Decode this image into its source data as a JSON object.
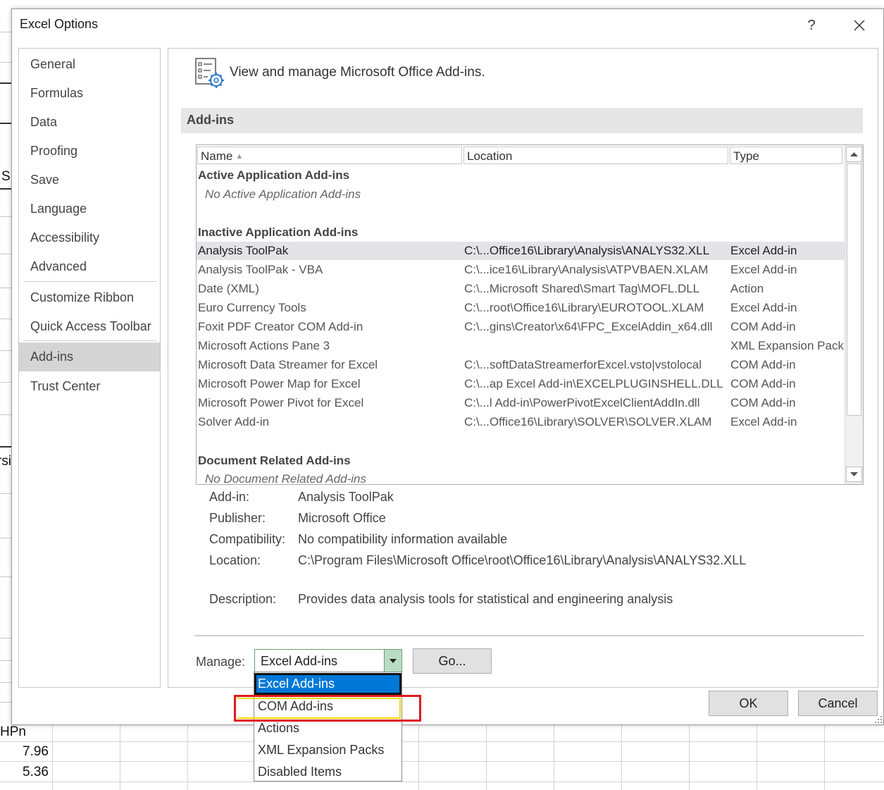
{
  "window": {
    "title": "Excel Options",
    "help_label": "?"
  },
  "sheet": {
    "cells": [
      "S",
      "rsi",
      "HPn",
      "7.96",
      "5.36"
    ]
  },
  "nav": {
    "items": [
      {
        "label": "General"
      },
      {
        "label": "Formulas"
      },
      {
        "label": "Data"
      },
      {
        "label": "Proofing"
      },
      {
        "label": "Save"
      },
      {
        "label": "Language"
      },
      {
        "label": "Accessibility"
      },
      {
        "label": "Advanced"
      },
      {
        "label": "Customize Ribbon"
      },
      {
        "label": "Quick Access Toolbar"
      },
      {
        "label": "Add-ins"
      },
      {
        "label": "Trust Center"
      }
    ],
    "active": "Add-ins"
  },
  "header": {
    "title": "View and manage Microsoft Office Add-ins.",
    "icon": "addins-settings-icon"
  },
  "section": {
    "title": "Add-ins"
  },
  "list": {
    "columns": [
      "Name",
      "Location",
      "Type"
    ],
    "groups": {
      "active_title": "Active Application Add-ins",
      "active_empty": "No Active Application Add-ins",
      "inactive_title": "Inactive Application Add-ins",
      "document_title": "Document Related Add-ins",
      "document_empty": "No Document Related Add-ins"
    },
    "rows": [
      {
        "name": "Analysis ToolPak",
        "location": "C:\\...Office16\\Library\\Analysis\\ANALYS32.XLL",
        "type": "Excel Add-in"
      },
      {
        "name": "Analysis ToolPak - VBA",
        "location": "C:\\...ice16\\Library\\Analysis\\ATPVBAEN.XLAM",
        "type": "Excel Add-in"
      },
      {
        "name": "Date (XML)",
        "location": "C:\\...Microsoft Shared\\Smart Tag\\MOFL.DLL",
        "type": "Action"
      },
      {
        "name": "Euro Currency Tools",
        "location": "C:\\...root\\Office16\\Library\\EUROTOOL.XLAM",
        "type": "Excel Add-in"
      },
      {
        "name": "Foxit PDF Creator COM Add-in",
        "location": "C:\\...gins\\Creator\\x64\\FPC_ExcelAddin_x64.dll",
        "type": "COM Add-in"
      },
      {
        "name": "Microsoft Actions Pane 3",
        "location": "",
        "type": "XML Expansion Pack"
      },
      {
        "name": "Microsoft Data Streamer for Excel",
        "location": "C:\\...softDataStreamerforExcel.vsto|vstolocal",
        "type": "COM Add-in"
      },
      {
        "name": "Microsoft Power Map for Excel",
        "location": "C:\\...ap Excel Add-in\\EXCELPLUGINSHELL.DLL",
        "type": "COM Add-in"
      },
      {
        "name": "Microsoft Power Pivot for Excel",
        "location": "C:\\...l Add-in\\PowerPivotExcelClientAddIn.dll",
        "type": "COM Add-in"
      },
      {
        "name": "Solver Add-in",
        "location": "C:\\...Office16\\Library\\SOLVER\\SOLVER.XLAM",
        "type": "Excel Add-in"
      }
    ],
    "selected_row": 0
  },
  "details": {
    "addin_label": "Add-in:",
    "addin_value": "Analysis ToolPak",
    "publisher_label": "Publisher:",
    "publisher_value": "Microsoft Office",
    "compat_label": "Compatibility:",
    "compat_value": "No compatibility information available",
    "location_label": "Location:",
    "location_value": "C:\\Program Files\\Microsoft Office\\root\\Office16\\Library\\Analysis\\ANALYS32.XLL",
    "description_label": "Description:",
    "description_value": "Provides data analysis tools for statistical and engineering analysis"
  },
  "manage": {
    "label": "Manage:",
    "selected": "Excel Add-ins",
    "go_label": "Go...",
    "options": [
      "Excel Add-ins",
      "COM Add-ins",
      "Actions",
      "XML Expansion Packs",
      "Disabled Items"
    ]
  },
  "buttons": {
    "ok": "OK",
    "cancel": "Cancel"
  },
  "colors": {
    "selection_blue": "#0078d7",
    "highlight_red": "#e0191f",
    "highlight_yellow": "#f3dc00",
    "dropdown_arrow_green": "#b9dcc4"
  }
}
